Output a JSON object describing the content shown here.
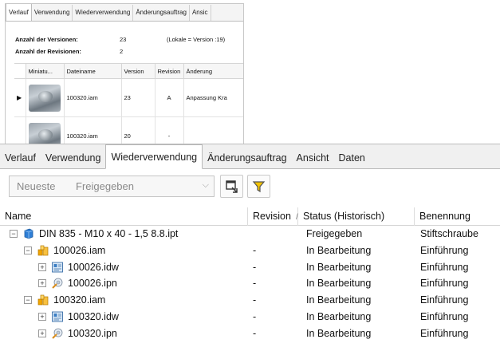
{
  "top_panel": {
    "tabs": [
      "Verlauf",
      "Verwendung",
      "Wiederverwendung",
      "Änderungsauftrag",
      "Ansic"
    ],
    "active_tab": 0,
    "info": [
      {
        "label": "Anzahl der Versionen:",
        "value": "23",
        "extra": "(Lokale = Version :19)"
      },
      {
        "label": "Anzahl der Revisionen:",
        "value": "2",
        "extra": ""
      }
    ],
    "columns": [
      "Miniatu...",
      "Dateiname",
      "Version",
      "Revision",
      "Änderung"
    ],
    "rows": [
      {
        "file": "100320.iam",
        "version": "23",
        "revision": "A",
        "change": "Anpassung Kra",
        "selected": true
      },
      {
        "file": "100320.iam",
        "version": "20",
        "revision": "-",
        "change": "",
        "selected": false
      }
    ]
  },
  "main": {
    "tabs": [
      "Verlauf",
      "Verwendung",
      "Wiederverwendung",
      "Änderungsauftrag",
      "Ansicht",
      "Daten"
    ],
    "active_tab": 2,
    "filter": {
      "option1": "Neueste",
      "option2": "Freigegeben"
    },
    "columns": {
      "name": "Name",
      "revision": "Revision",
      "status": "Status (Historisch)",
      "benennung": "Benennung"
    },
    "rows": [
      {
        "indent": 0,
        "expander": "⊟",
        "icon": "part-icon",
        "name": "DIN 835 - M10 x 40 - 1,5 8.8.ipt",
        "revision": "",
        "status": "Freigegeben",
        "benennung": "Stiftschraube"
      },
      {
        "indent": 1,
        "expander": "⊟",
        "icon": "assembly-icon",
        "name": "100026.iam",
        "revision": "-",
        "status": "In Bearbeitung",
        "benennung": "Einführung"
      },
      {
        "indent": 2,
        "expander": "⊞",
        "icon": "drawing-icon",
        "name": "100026.idw",
        "revision": "-",
        "status": "In Bearbeitung",
        "benennung": "Einführung"
      },
      {
        "indent": 2,
        "expander": "⊞",
        "icon": "presentation-icon",
        "name": "100026.ipn",
        "revision": "-",
        "status": "In Bearbeitung",
        "benennung": "Einführung"
      },
      {
        "indent": 1,
        "expander": "⊟",
        "icon": "assembly-icon",
        "name": "100320.iam",
        "revision": "-",
        "status": "In Bearbeitung",
        "benennung": "Einführung"
      },
      {
        "indent": 2,
        "expander": "⊞",
        "icon": "drawing-icon",
        "name": "100320.idw",
        "revision": "-",
        "status": "In Bearbeitung",
        "benennung": "Einführung"
      },
      {
        "indent": 2,
        "expander": "⊞",
        "icon": "presentation-icon",
        "name": "100320.ipn",
        "revision": "-",
        "status": "In Bearbeitung",
        "benennung": "Einführung"
      }
    ]
  }
}
